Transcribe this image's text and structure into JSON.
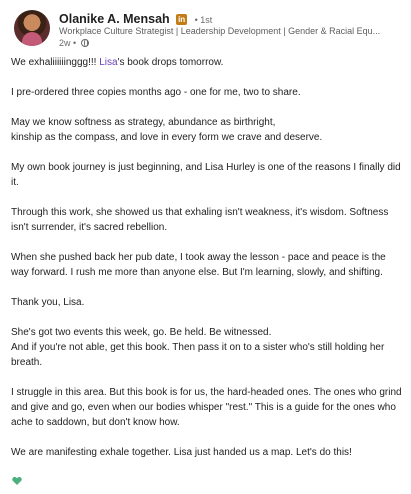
{
  "author": {
    "name": "Olanike A. Mensah",
    "badge": "in",
    "degree": "• 1st",
    "headline": "Workplace Culture Strategist | Leadership Development | Gender & Racial Equ...",
    "time": "2w •"
  },
  "post": {
    "p1_start": "We exhaliiiiiinggg!!! ",
    "p1_mention": "Lisa",
    "p1_end": "'s book drops tomorrow.",
    "p2": "I pre-ordered three copies months ago - one for me, two to share.",
    "p3_line1": "May we know softness as strategy, abundance as birthright,",
    "p3_line2": "kinship as the compass, and love in every form we crave and deserve.",
    "p4": "My own book journey is just beginning, and Lisa Hurley is one of the reasons I finally did it.",
    "p5": "Through this work, she showed us that exhaling isn't weakness, it's wisdom. Softness isn't surrender, it's sacred rebellion.",
    "p6": "When she pushed back her pub date, I took away the lesson - pace and peace is the way forward. I rush me more than anyone else. But I'm learning, slowly, and shifting.",
    "p7": "Thank you, Lisa.",
    "p8_line1": "She's got two events this week, go. Be held. Be witnessed.",
    "p8_line2": "And if you're not able, get this book. Then pass it on to a sister who's still holding her breath.",
    "p9": "I struggle in this area. But this book is for us, the hard-headed ones. The ones who grind and give and go, even when our bodies whisper \"rest.\" This is a guide for the ones who ache to saddown, but don't know how.",
    "p10": "We are manifesting exhale together. Lisa just handed us a map. Let's do this!"
  },
  "colors": {
    "mention": "#6b3fb5",
    "heart": "#4caf7d",
    "badge": "#c37d16"
  },
  "icons": [
    "globe-icon",
    "green-heart-icon"
  ]
}
